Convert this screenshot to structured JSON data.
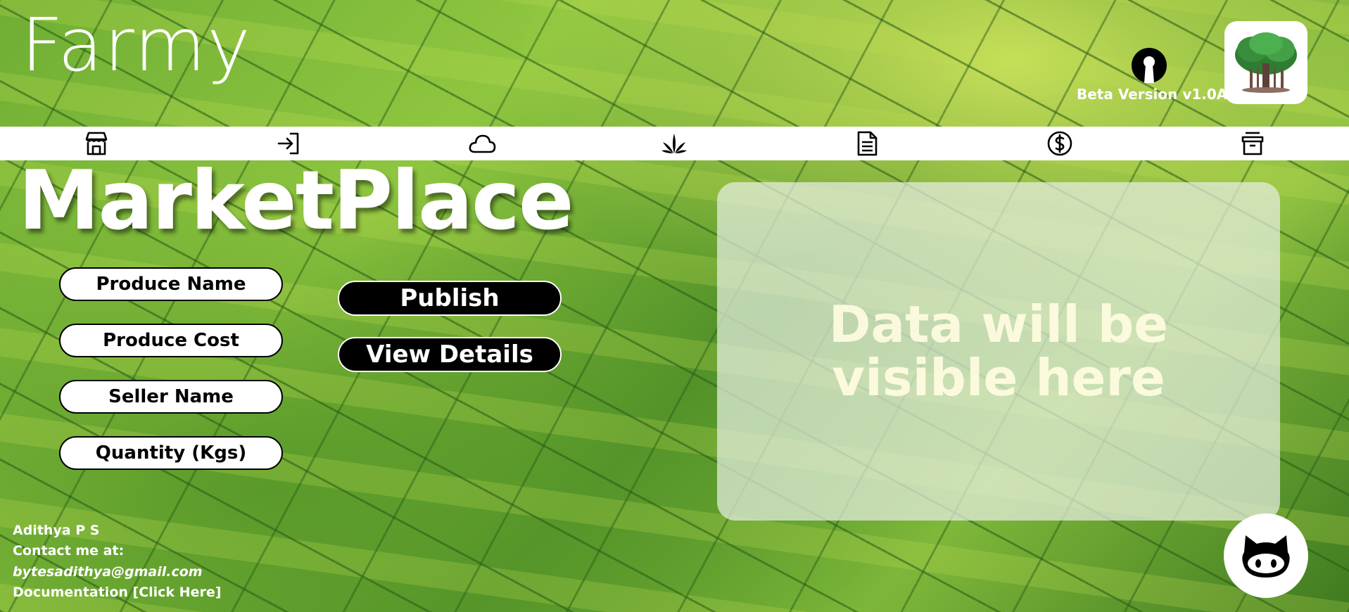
{
  "header": {
    "brand": "Farmy",
    "beta_label": "Beta Version v1.0A",
    "logo_icon": "banyan-tree-logo",
    "beta_icon": "keyhole-icon"
  },
  "nav": [
    {
      "name": "marketplace",
      "icon": "store-icon"
    },
    {
      "name": "login",
      "icon": "login-icon"
    },
    {
      "name": "weather",
      "icon": "cloud-icon"
    },
    {
      "name": "crops",
      "icon": "plant-icon"
    },
    {
      "name": "documents",
      "icon": "document-icon"
    },
    {
      "name": "finance",
      "icon": "dollar-icon"
    },
    {
      "name": "archive",
      "icon": "archive-icon"
    }
  ],
  "page": {
    "title": "MarketPlace"
  },
  "form": {
    "produce_name_placeholder": "Produce Name",
    "produce_cost_placeholder": "Produce Cost",
    "seller_name_placeholder": "Seller Name",
    "quantity_placeholder": "Quantity (Kgs)"
  },
  "actions": {
    "publish_label": "Publish",
    "view_details_label": "View Details"
  },
  "panel": {
    "placeholder_text": "Data will be visible here"
  },
  "footer": {
    "author": "Adithya P S",
    "contact_label": "Contact me at:",
    "email": "bytesadithya@gmail.com",
    "documentation_label": "Documentation [Click Here]"
  },
  "colors": {
    "field_green": "#6fae34",
    "panel_text": "#fffce1",
    "button_bg": "#000000"
  }
}
